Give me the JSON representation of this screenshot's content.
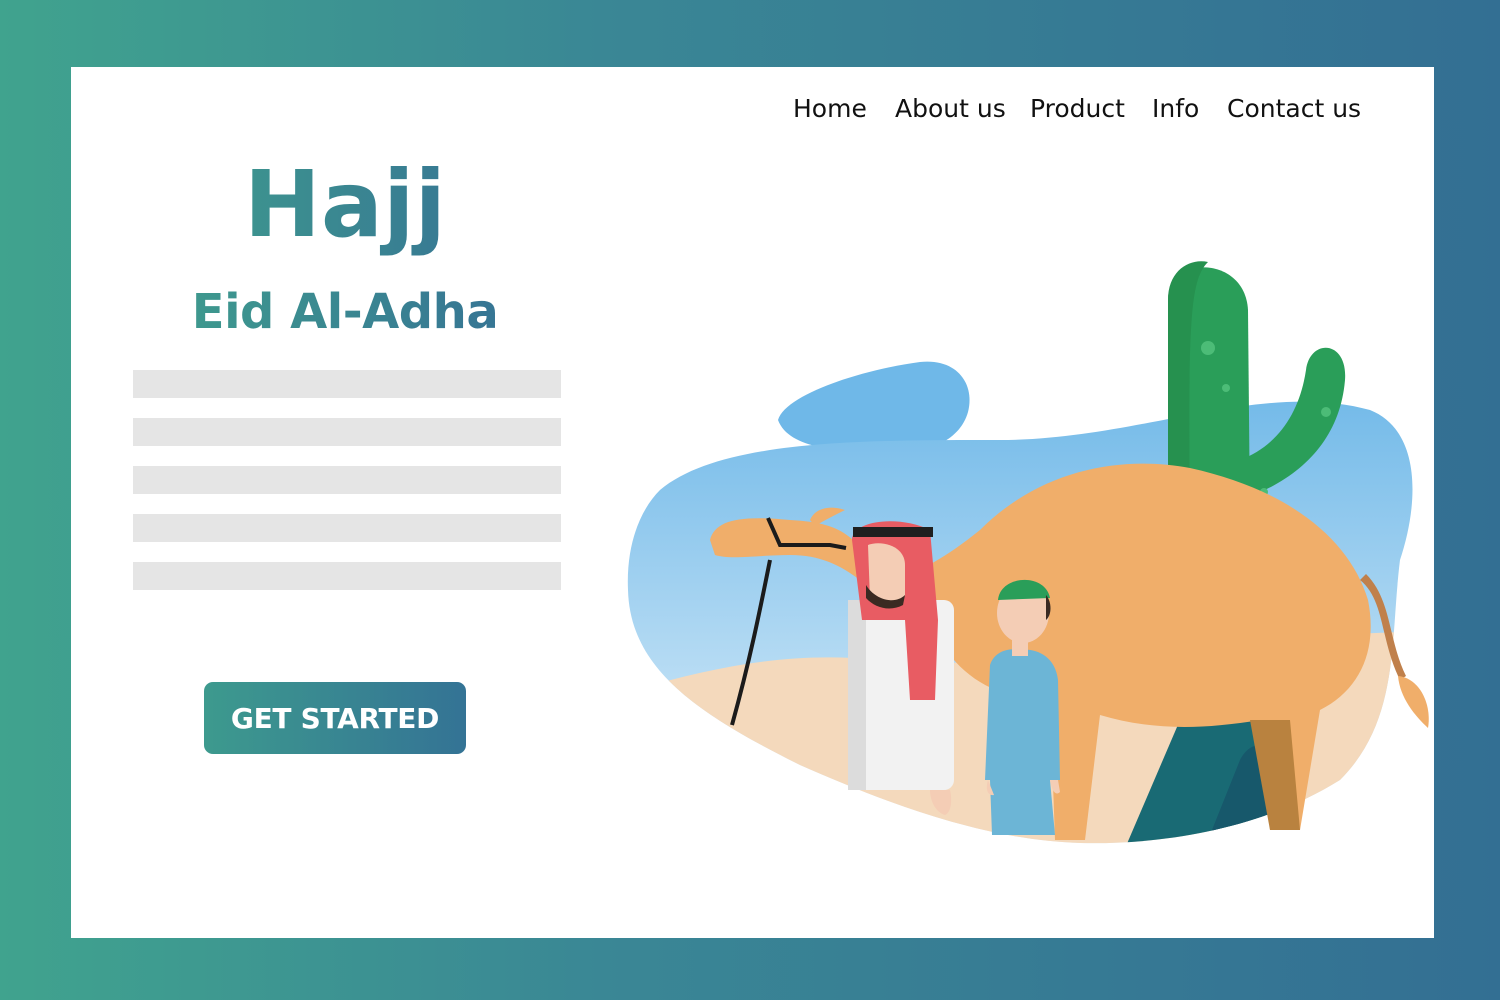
{
  "nav": {
    "items": [
      "Home",
      "About us",
      "Product",
      "Info",
      "Contact us"
    ]
  },
  "hero": {
    "title": "Hajj",
    "subtitle": "Eid Al-Adha",
    "cta_label": "GET STARTED",
    "placeholder_line_count": 5
  },
  "illustration": {
    "icons": [
      "camel-icon",
      "man-icon",
      "boy-icon",
      "cactus-icon",
      "cloud-icon",
      "sand-dune-icon"
    ]
  },
  "colors": {
    "gradient_start": "#40a38e",
    "gradient_end": "#336f93",
    "placeholder": "#e5e5e5",
    "sky": "#6fb8e8",
    "camel": "#f0ae6a",
    "cactus": "#2a9e59",
    "headdress": "#e85c63"
  }
}
